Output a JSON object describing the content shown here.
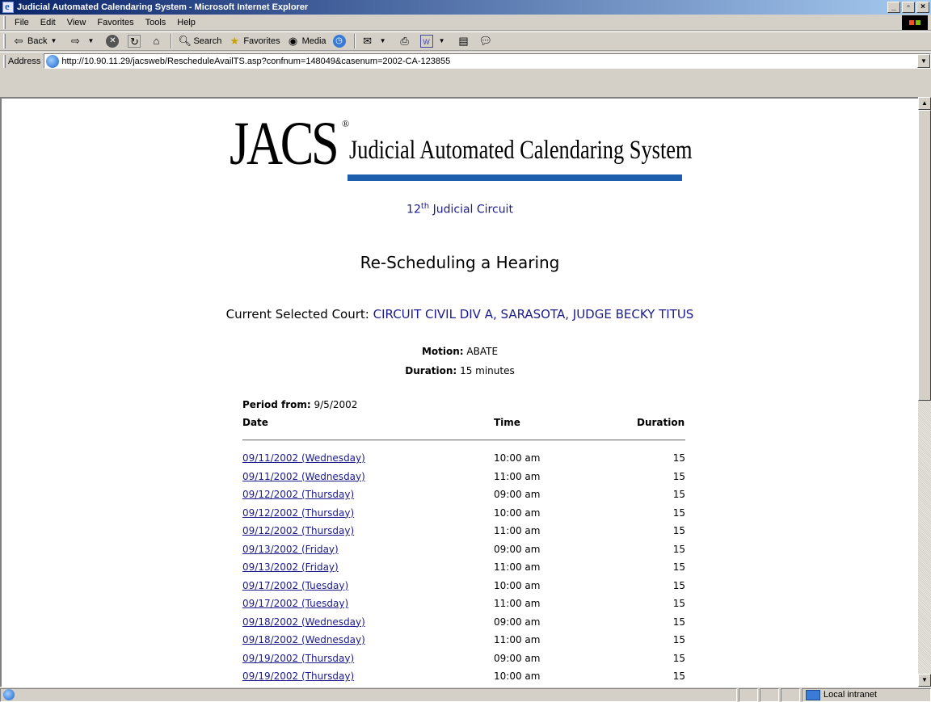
{
  "window": {
    "title": "Judicial Automated Calendaring System - Microsoft Internet Explorer",
    "minimize": "_",
    "maximize": "▫",
    "close": "×"
  },
  "menu": [
    "File",
    "Edit",
    "View",
    "Favorites",
    "Tools",
    "Help"
  ],
  "toolbar": {
    "back": "Back",
    "search": "Search",
    "favorites": "Favorites",
    "media": "Media"
  },
  "address": {
    "label": "Address",
    "url": "http://10.90.11.29/jacsweb/RescheduleAvailTS.asp?confnum=148049&casenum=2002-CA-123855"
  },
  "logo": {
    "short": "JACS",
    "reg": "®",
    "full": "Judicial Automated Calendaring System"
  },
  "circuit": {
    "num": "12",
    "sup": "th",
    "label": "Judicial Circuit"
  },
  "page_title": "Re-Scheduling a Hearing",
  "court": {
    "label": "Current Selected Court:",
    "value": "CIRCUIT CIVIL DIV A, SARASOTA, JUDGE BECKY TITUS"
  },
  "motion": {
    "label": "Motion:",
    "value": "ABATE"
  },
  "duration": {
    "label": "Duration:",
    "value": "15 minutes"
  },
  "period": {
    "label": "Period from:",
    "value": "9/5/2002"
  },
  "table": {
    "headers": {
      "date": "Date",
      "time": "Time",
      "duration": "Duration"
    },
    "rows": [
      {
        "date": "09/11/2002 (Wednesday)",
        "time": "10:00 am",
        "duration": "15"
      },
      {
        "date": "09/11/2002 (Wednesday)",
        "time": "11:00 am",
        "duration": "15"
      },
      {
        "date": "09/12/2002 (Thursday)",
        "time": "09:00 am",
        "duration": "15"
      },
      {
        "date": "09/12/2002 (Thursday)",
        "time": "10:00 am",
        "duration": "15"
      },
      {
        "date": "09/12/2002 (Thursday)",
        "time": "11:00 am",
        "duration": "15"
      },
      {
        "date": "09/13/2002 (Friday)",
        "time": "09:00 am",
        "duration": "15"
      },
      {
        "date": "09/13/2002 (Friday)",
        "time": "11:00 am",
        "duration": "15"
      },
      {
        "date": "09/17/2002 (Tuesday)",
        "time": "10:00 am",
        "duration": "15"
      },
      {
        "date": "09/17/2002 (Tuesday)",
        "time": "11:00 am",
        "duration": "15"
      },
      {
        "date": "09/18/2002 (Wednesday)",
        "time": "09:00 am",
        "duration": "15"
      },
      {
        "date": "09/18/2002 (Wednesday)",
        "time": "11:00 am",
        "duration": "15"
      },
      {
        "date": "09/19/2002 (Thursday)",
        "time": "09:00 am",
        "duration": "15"
      },
      {
        "date": "09/19/2002 (Thursday)",
        "time": "10:00 am",
        "duration": "15"
      }
    ]
  },
  "status": {
    "zone": "Local intranet"
  },
  "colors": {
    "link": "#1a1a8c",
    "logo_bar": "#1e5fad",
    "titlebar": "#0a246a"
  }
}
